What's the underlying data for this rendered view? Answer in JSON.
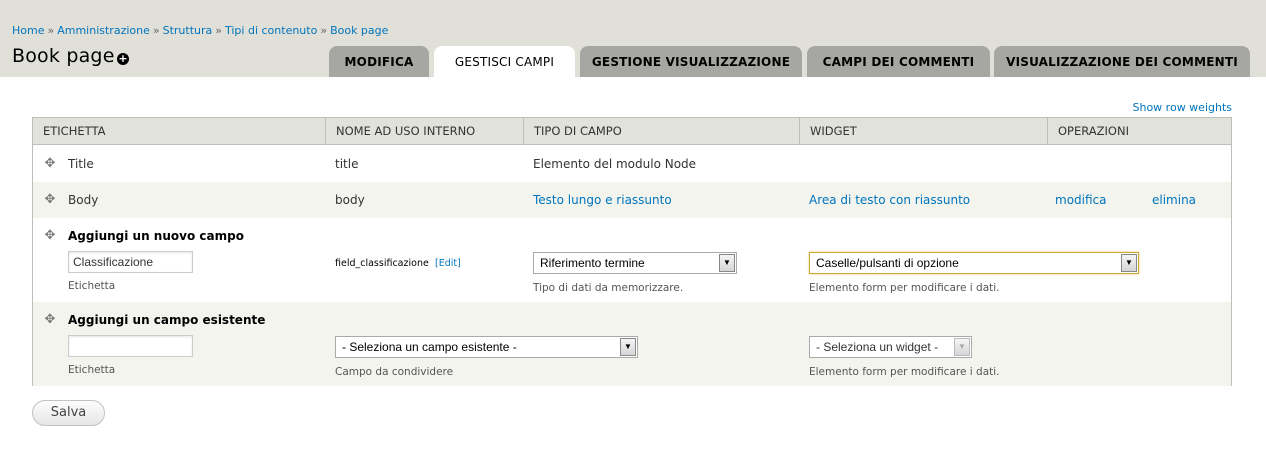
{
  "breadcrumb": {
    "items": [
      "Home",
      "Amministrazione",
      "Struttura",
      "Tipi di contenuto",
      "Book page"
    ],
    "separator": "»"
  },
  "page_title": "Book page",
  "shortcut_icon": "plus-circle-icon",
  "tabs": [
    {
      "label": "Modifica",
      "active": false
    },
    {
      "label": "Gestisci campi",
      "active": true
    },
    {
      "label": "Gestione visualizzazione",
      "active": false
    },
    {
      "label": "Campi dei commenti",
      "active": false
    },
    {
      "label": "Visualizzazione dei commenti",
      "active": false
    }
  ],
  "row_weights_link": "Show row weights",
  "table": {
    "headers": [
      "Etichetta",
      "Nome ad uso interno",
      "Tipo di campo",
      "Widget",
      "Operazioni"
    ],
    "rows": [
      {
        "label": "Title",
        "machine_name": "title",
        "field_type": "Elemento del modulo Node",
        "widget": "",
        "edit": "",
        "delete": ""
      },
      {
        "label": "Body",
        "machine_name": "body",
        "field_type": "Testo lungo e riassunto",
        "widget": "Area di testo con riassunto",
        "edit": "modifica",
        "delete": "elimina"
      }
    ],
    "add_new": {
      "title": "Aggiungi un nuovo campo",
      "label_value": "Classificazione",
      "label_desc": "Etichetta",
      "machine_name": "field_classificazione",
      "machine_edit": "[Edit]",
      "type_selected": "Riferimento termine",
      "type_desc": "Tipo di dati da memorizzare.",
      "widget_selected": "Caselle/pulsanti di opzione",
      "widget_desc": "Elemento form per modificare i dati."
    },
    "add_existing": {
      "title": "Aggiungi un campo esistente",
      "label_value": "",
      "label_desc": "Etichetta",
      "field_selected": "- Seleziona un campo esistente -",
      "field_desc": "Campo da condividere",
      "widget_selected": "- Seleziona un widget -",
      "widget_desc": "Elemento form per modificare i dati."
    }
  },
  "save_label": "Salva",
  "colors": {
    "link": "#0074bd",
    "header_bg": "#e0e0d8",
    "tab_bg": "#a6a7a2",
    "table_header_bg": "#e1e2dc",
    "even_row_bg": "#f3f4ee"
  }
}
